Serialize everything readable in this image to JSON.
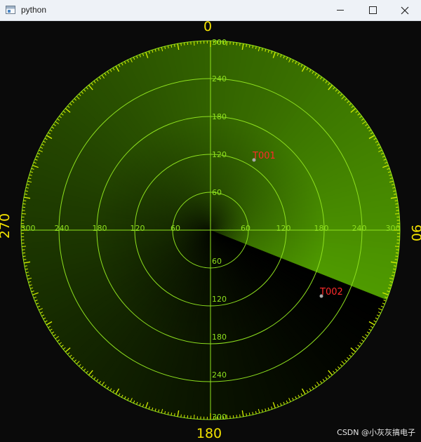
{
  "window": {
    "title": "python"
  },
  "radar": {
    "bearing_labels": {
      "top": "0",
      "right": "90",
      "bottom": "180",
      "left": "270"
    },
    "range_labels": [
      "60",
      "120",
      "180",
      "240",
      "300"
    ],
    "targets": [
      {
        "id": "T001"
      },
      {
        "id": "T002"
      }
    ],
    "colors": {
      "grid": "#8ee01e",
      "tick": "#d8f000",
      "bearing_text": "#f2e100",
      "target_label": "#ff2a2a",
      "sweep": "#4f9a00",
      "sweep_dark": "#0a0a0a"
    }
  },
  "watermark": "CSDN @小灰灰搞电子"
}
